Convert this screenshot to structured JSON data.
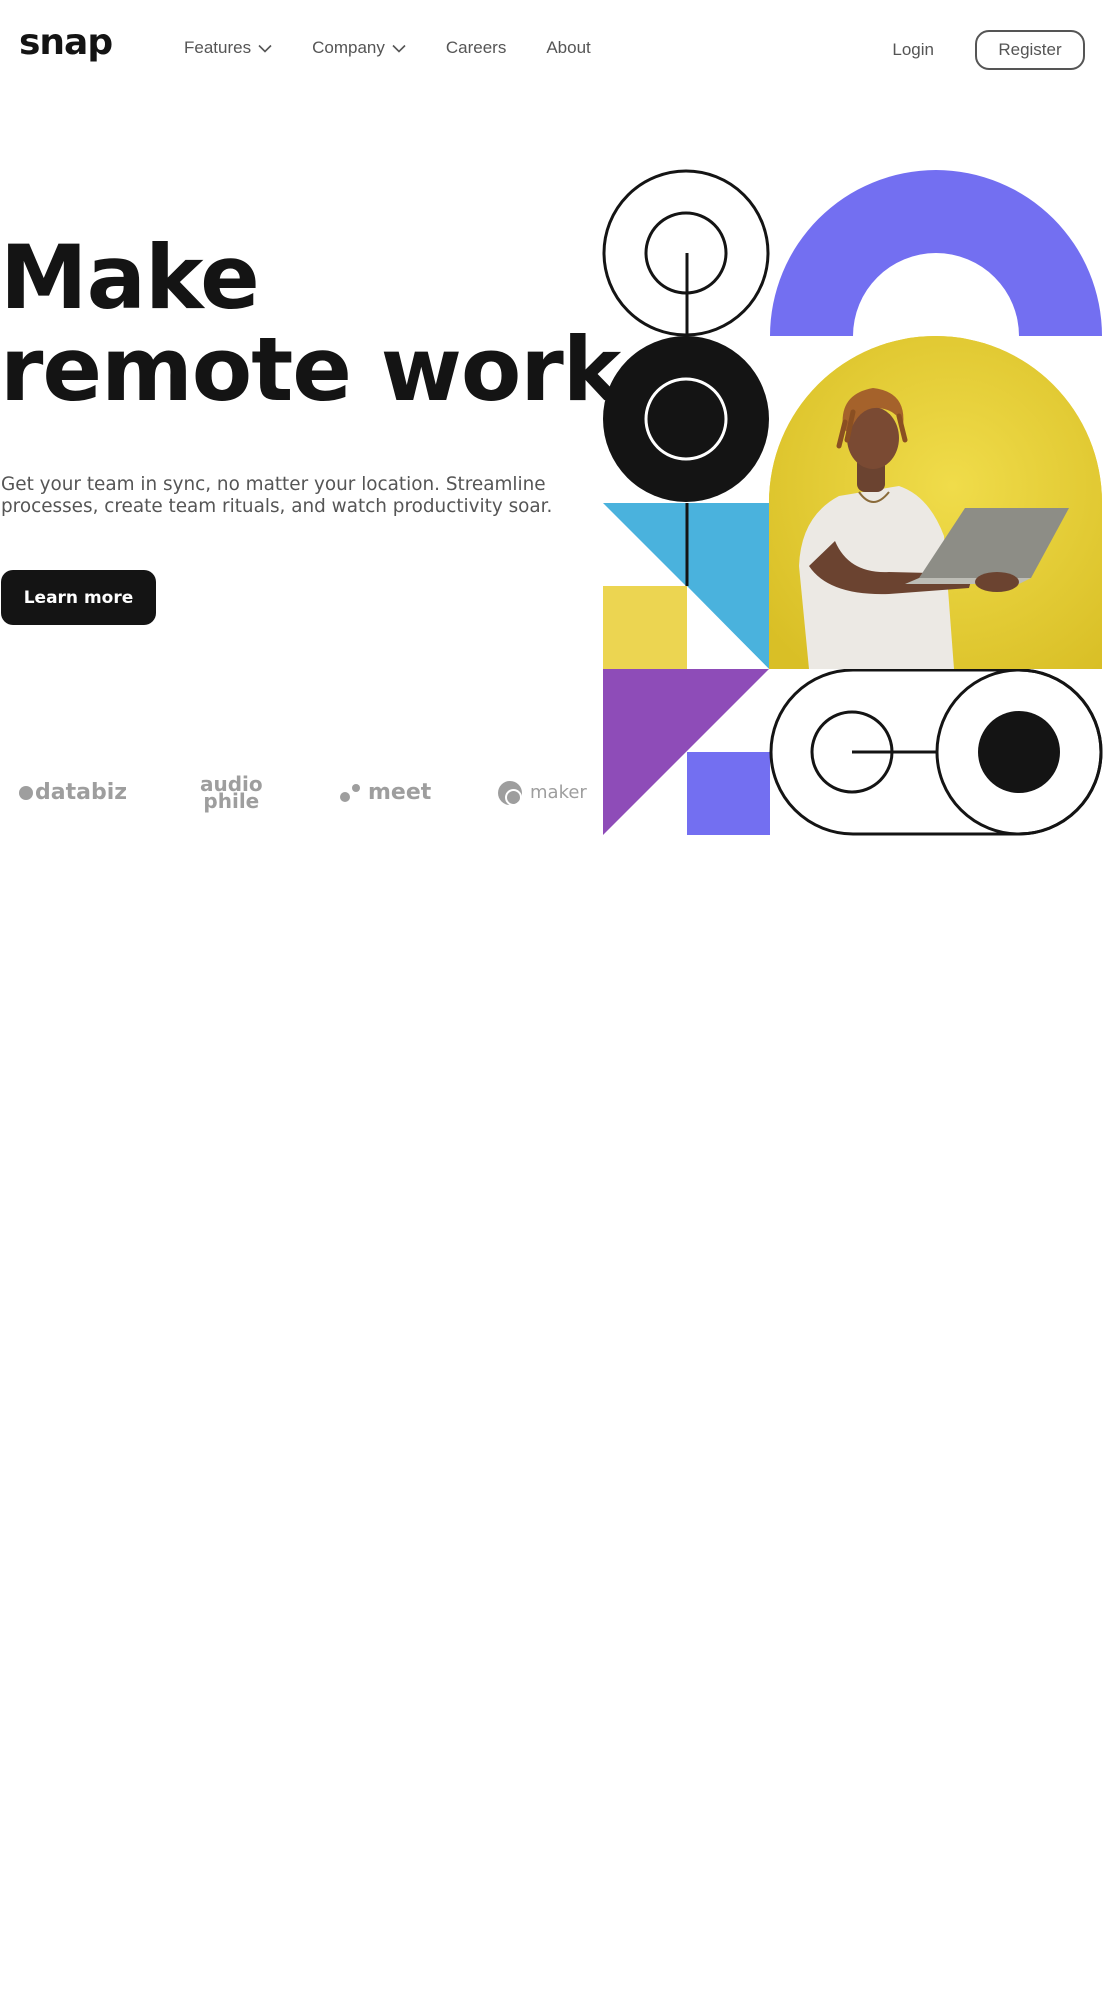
{
  "brand": {
    "logo": "snap"
  },
  "nav": {
    "items": [
      {
        "label": "Features",
        "has_dropdown": true
      },
      {
        "label": "Company",
        "has_dropdown": true
      },
      {
        "label": "Careers",
        "has_dropdown": false
      },
      {
        "label": "About",
        "has_dropdown": false
      }
    ],
    "login_label": "Login",
    "register_label": "Register"
  },
  "hero": {
    "title_line1": "Make",
    "title_line2": "remote work",
    "subtitle": "Get your team in sync, no matter your location. Streamline processes, create team rituals, and watch productivity soar.",
    "cta_label": "Learn more"
  },
  "clients": {
    "databiz": "databiz",
    "audiophile_top": "audio",
    "audiophile_bottom": "phile",
    "meet": "meet",
    "maker": "maker"
  },
  "colors": {
    "dark": "#141414",
    "gray_text": "#555555",
    "logo_gray": "#9e9e9e",
    "purple": "#736ff1",
    "violet": "#8e4cb8",
    "yellow": "#ecd551",
    "blue": "#4ab2dd",
    "photo_bg": "#e6cf35"
  }
}
